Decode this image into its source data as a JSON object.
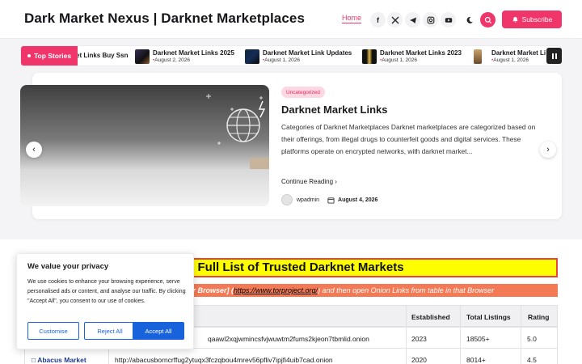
{
  "header": {
    "site_title": "Dark Market Nexus | Darknet Marketplaces",
    "nav_home": "Home",
    "social_icons": [
      "facebook-icon",
      "x-icon",
      "telegram-icon",
      "instagram-icon",
      "youtube-icon"
    ],
    "subscribe_label": "Subscribe"
  },
  "ticker": {
    "label": "Top Stories",
    "items": [
      {
        "title": "et Links Buy Ssn",
        "date": ""
      },
      {
        "title": "Darknet Market Links 2025",
        "date": "August 2, 2026"
      },
      {
        "title": "Darknet Market Link Updates",
        "date": "August 1, 2026"
      },
      {
        "title": "Darknet Market Links 2023",
        "date": "August 1, 2026"
      },
      {
        "title": "Darknet Market Li",
        "date": "August 1, 2026"
      }
    ]
  },
  "feature": {
    "badge": "Uncategorized",
    "title": "Darknet Market Links",
    "excerpt": "Categories of Darknet Marketplaces Darknet marketplaces are categorized based on their offerings, from illegal drugs to counterfeit goods and digital services. These platforms operate on encrypted networks, with darknet market...",
    "continue_label": "Continue Reading",
    "author": "wpadmin",
    "date": "August 4, 2026"
  },
  "content": {
    "banner_heading": "e Full List of Trusted Darknet Markets",
    "strip_prefix": "for Browser",
    "strip_mid": "] (",
    "strip_link": "https://www.torproject.org/",
    "strip_suffix": ") and then open Onion Links from table in that Browser"
  },
  "table": {
    "headers": [
      "Established",
      "Total Listings",
      "Rating"
    ],
    "rows": [
      {
        "name": "",
        "link": "qaawl2xqjwmincsfvjwuwtm2fums2kjeon7tbmlid.onion",
        "established": "2023",
        "listings": "18505+",
        "rating": "5.0"
      },
      {
        "name": "Abacus Market",
        "link": "http://abacusborncrffug2ytuqx3fczqbou4mrev56pfliv7ipjfi4uib7cad.onion",
        "established": "2020",
        "listings": "8014+",
        "rating": "4.5"
      }
    ]
  },
  "cookie": {
    "title": "We value your privacy",
    "text": "We use cookies to enhance your browsing experience, serve personalised ads or content, and analyse our traffic. By clicking \"Accept All\", you consent to our use of cookies.",
    "customise": "Customise",
    "reject": "Reject All",
    "accept": "Accept All"
  },
  "colors": {
    "accent": "#f0356b",
    "banner_yellow": "#ffff00",
    "banner_border": "#e8453c",
    "strip_orange": "#f47a55",
    "cookie_blue": "#1863dc"
  }
}
